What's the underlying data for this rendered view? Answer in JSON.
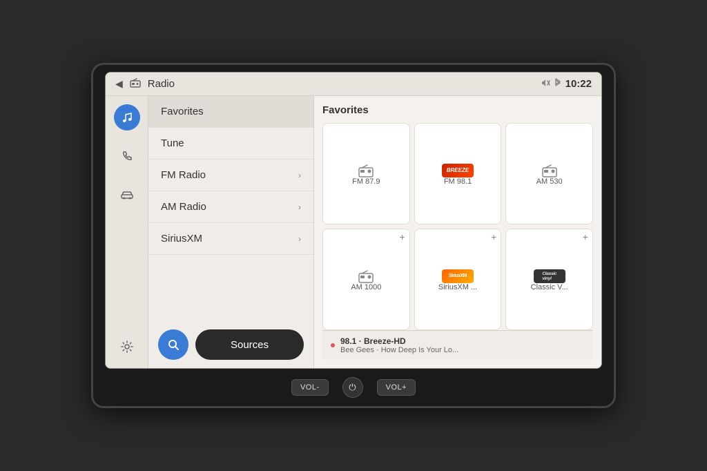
{
  "app": {
    "title": "Radio",
    "time": "10:22"
  },
  "header": {
    "back_label": "◄",
    "radio_icon": "🖥",
    "title": "Radio",
    "status": {
      "mute_icon": "mute-icon",
      "bluetooth_icon": "bluetooth-icon",
      "time": "10:22"
    }
  },
  "sidebar": {
    "items": [
      {
        "icon": "music-icon",
        "label": "Music",
        "active": true
      },
      {
        "icon": "phone-icon",
        "label": "Phone",
        "active": false
      },
      {
        "icon": "car-icon",
        "label": "Car",
        "active": false
      },
      {
        "icon": "settings-icon",
        "label": "Settings",
        "active": false
      }
    ]
  },
  "menu": {
    "items": [
      {
        "label": "Favorites",
        "hasChevron": false
      },
      {
        "label": "Tune",
        "hasChevron": false
      },
      {
        "label": "FM Radio",
        "hasChevron": true
      },
      {
        "label": "AM Radio",
        "hasChevron": true
      },
      {
        "label": "SiriusXM",
        "hasChevron": true
      }
    ],
    "search_label": "🔍",
    "sources_label": "Sources"
  },
  "content": {
    "title": "Favorites",
    "favorites": [
      {
        "id": "fav1",
        "label": "FM 87.9",
        "type": "radio",
        "hasAdd": false
      },
      {
        "id": "fav2",
        "label": "FM 98.1",
        "type": "logo-fm981",
        "hasAdd": false
      },
      {
        "id": "fav3",
        "label": "AM 530",
        "type": "radio",
        "hasAdd": false
      },
      {
        "id": "fav4",
        "label": "AM 1000",
        "type": "radio",
        "hasAdd": true
      },
      {
        "id": "fav5",
        "label": "SiriusXM ...",
        "type": "logo-sirius",
        "hasAdd": true
      },
      {
        "id": "fav6",
        "label": "Classic V...",
        "type": "logo-classic",
        "hasAdd": true
      }
    ]
  },
  "now_playing": {
    "station": "98.1 · Breeze-HD",
    "track": "Bee Gees · How Deep Is Your Lo...",
    "indicator_color": "#e05555"
  },
  "controls": {
    "vol_minus": "VOL-",
    "power": "⏻",
    "vol_plus": "VOL+"
  }
}
